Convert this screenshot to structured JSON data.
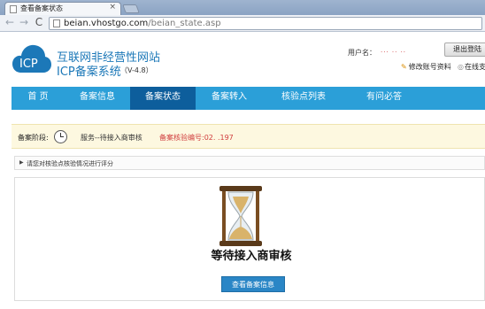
{
  "browser": {
    "tab_title": "查看备案状态",
    "tab_close": "×",
    "url_host": "beian.vhostgo.com",
    "url_path": "/beian_state.asp",
    "back_glyph": "←",
    "forward_glyph": "→",
    "reload_glyph": "C"
  },
  "header": {
    "logo_text": "ICP",
    "site_title": "互联网非经营性网站",
    "site_subtitle": "ICP备案系统",
    "version": "（V-4.8）",
    "user_label": "用户名：",
    "user_name": "··· ·· ··",
    "logout_label": "退出登陆",
    "edit_profile_label": "修改账号资料",
    "online_label": "在线支"
  },
  "nav": {
    "items": [
      {
        "label": "首 页"
      },
      {
        "label": "备案信息"
      },
      {
        "label": "备案状态"
      },
      {
        "label": "备案转入"
      },
      {
        "label": "核验点列表"
      },
      {
        "label": "有问必答"
      }
    ],
    "active_index": 2
  },
  "stage": {
    "label": "备案阶段:",
    "status": "服务--待接入商审核",
    "code": "备案核验编号:02. .197"
  },
  "evaluation": {
    "text": "请您对核验点核验情况进行评分"
  },
  "content": {
    "icon": "hourglass-icon",
    "title": "等待接入商审核",
    "view_button_label": "查看备案信息"
  },
  "colors": {
    "nav_bg": "#2b9fd8",
    "nav_active": "#0d5e9c",
    "brand_blue": "#1c78b8",
    "stage_code_red": "#d03c3c"
  }
}
